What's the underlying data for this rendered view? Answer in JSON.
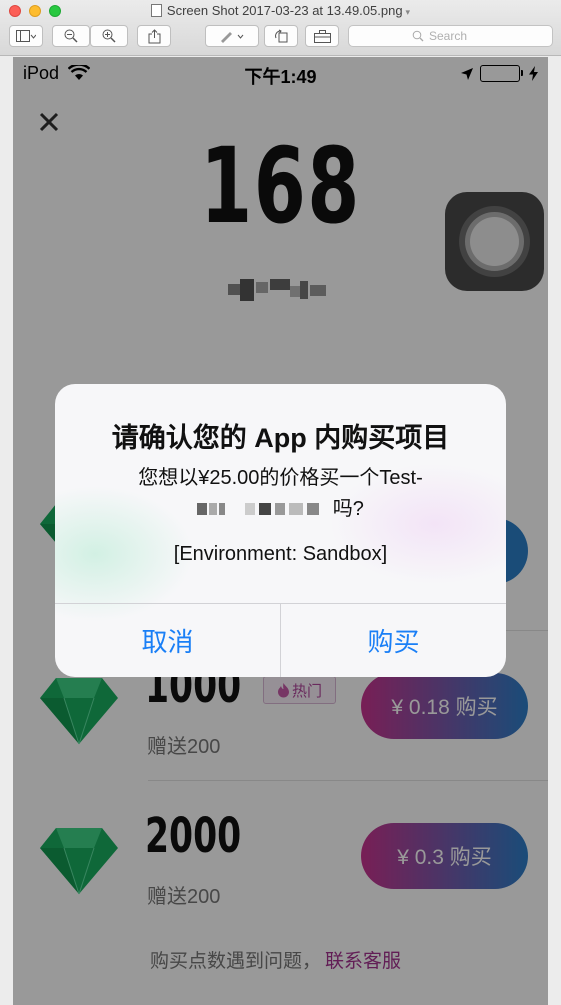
{
  "window": {
    "title": "Screen Shot 2017-03-23 at 13.49.05.png",
    "search_placeholder": "Search"
  },
  "status_bar": {
    "carrier": "iPod",
    "time": "下午1:49"
  },
  "balance": {
    "points": "168"
  },
  "packages": [
    {
      "amount": "1000",
      "bonus": "赠送200",
      "hot_label": "热门",
      "price_label": "¥ 0.18 购买"
    },
    {
      "amount": "2000",
      "bonus": "赠送200",
      "price_label": "¥ 0.3 购买"
    }
  ],
  "help": {
    "text": "购买点数遇到问题，",
    "link": "联系客服"
  },
  "alert": {
    "title": "请确认您的 App 内购买项目",
    "message_line1": "您想以¥25.00的价格买一个Test-",
    "message_tail": "吗?",
    "environment": "[Environment: Sandbox]",
    "cancel": "取消",
    "confirm": "购买"
  },
  "colors": {
    "ios_blue": "#1a7ff6",
    "gem_green": "#1aae60",
    "pill_start": "#c8348f",
    "pill_end": "#2c7fc9",
    "link_purple": "#a4338f"
  }
}
